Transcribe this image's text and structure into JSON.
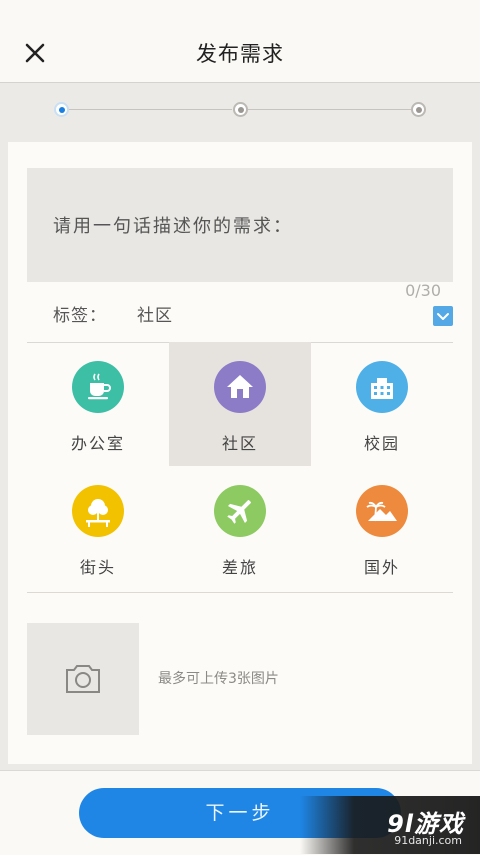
{
  "header": {
    "title": "发布需求",
    "close_icon": "close-icon"
  },
  "stepper": {
    "steps": 3,
    "current": 1,
    "active_color": "#1a7fe0"
  },
  "description": {
    "placeholder": "请用一句话描述你的需求：",
    "counter": "0/30"
  },
  "tag": {
    "label": "标签：",
    "value": "社区",
    "dropdown_icon": "chevron-down-icon"
  },
  "categories": [
    {
      "label": "办公室",
      "icon": "coffee-cup-icon",
      "color": "#3dbfa6"
    },
    {
      "label": "社区",
      "icon": "house-icon",
      "color": "#8c7cc8",
      "selected": true
    },
    {
      "label": "校园",
      "icon": "school-building-icon",
      "color": "#4fb0e8"
    },
    {
      "label": "街头",
      "icon": "tree-bench-icon",
      "color": "#f2c200"
    },
    {
      "label": "差旅",
      "icon": "airplane-icon",
      "color": "#8dcb62"
    },
    {
      "label": "国外",
      "icon": "palm-mountain-icon",
      "color": "#ee8a3d"
    }
  ],
  "photo": {
    "icon": "camera-icon",
    "hint": "最多可上传3张图片"
  },
  "footer": {
    "next_label": "下一步",
    "button_color": "#1f86e6"
  },
  "watermark": {
    "brand": "9l游戏",
    "site": "91danji.com"
  }
}
